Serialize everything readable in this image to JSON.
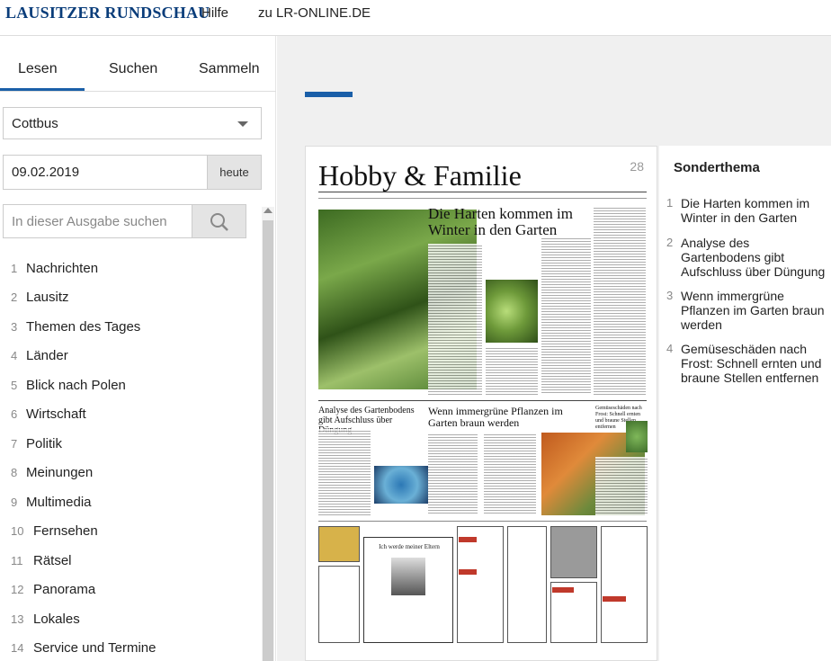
{
  "brand": {
    "name": "LAUSITZER RUNDSCHAU"
  },
  "topnav": {
    "help": "Hilfe",
    "site_link": "zu LR-ONLINE.DE"
  },
  "tabs": [
    {
      "label": "Lesen"
    },
    {
      "label": "Suchen"
    },
    {
      "label": "Sammeln"
    }
  ],
  "edition": {
    "selected": "Cottbus"
  },
  "date": {
    "value": "09.02.2019",
    "today_label": "heute"
  },
  "search": {
    "placeholder": "In dieser Ausgabe suchen"
  },
  "toc": [
    {
      "num": "1",
      "label": "Nachrichten"
    },
    {
      "num": "2",
      "label": "Lausitz"
    },
    {
      "num": "3",
      "label": "Themen des Tages"
    },
    {
      "num": "4",
      "label": "Länder"
    },
    {
      "num": "5",
      "label": "Blick nach Polen"
    },
    {
      "num": "6",
      "label": "Wirtschaft"
    },
    {
      "num": "7",
      "label": "Politik"
    },
    {
      "num": "8",
      "label": "Meinungen"
    },
    {
      "num": "9",
      "label": "Multimedia"
    },
    {
      "num": "10",
      "label": "Fernsehen"
    },
    {
      "num": "11",
      "label": "Rätsel"
    },
    {
      "num": "12",
      "label": "Panorama"
    },
    {
      "num": "13",
      "label": "Lokales"
    },
    {
      "num": "14",
      "label": "Service und Termine"
    }
  ],
  "page": {
    "section_title": "Hobby & Familie",
    "page_number": "28",
    "main_headline": "Die Harten kommen im Winter in den Garten",
    "headline_2": "Analyse des Gartenbodens gibt Aufschluss über Düngung",
    "headline_3": "Wenn immergrüne Pflanzen im Garten braun werden",
    "headline_4": "Gemüseschäden nach Frost: Schnell ernten und braune Stellen entfernen",
    "obituary_heading": "Ich werde meiner Eltern"
  },
  "special": {
    "title": "Sonderthema",
    "items": [
      {
        "num": "1",
        "label": "Die Harten kommen im Winter in den Garten"
      },
      {
        "num": "2",
        "label": "Analyse des Gartenbodens gibt Aufschluss über Düngung"
      },
      {
        "num": "3",
        "label": "Wenn immergrüne Pflanzen im Garten braun werden"
      },
      {
        "num": "4",
        "label": "Gemüseschäden nach Frost: Schnell ernten und braune Stellen entfernen"
      }
    ]
  },
  "colors": {
    "brand": "#0a3d7a",
    "accent": "#1a5fa8",
    "ad_red": "#c0392b"
  },
  "icons": {
    "search": "search-icon",
    "dropdown": "chevron-down-icon"
  }
}
